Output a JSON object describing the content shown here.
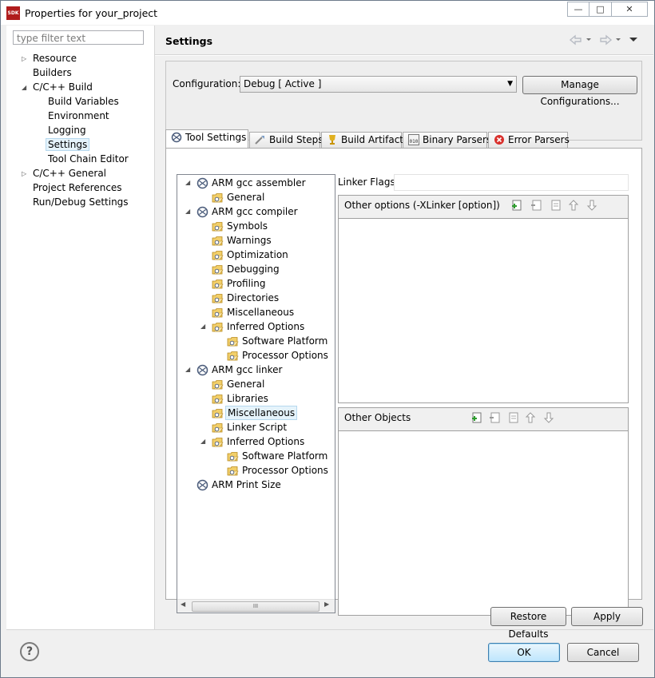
{
  "window": {
    "title": "Properties for your_project",
    "app_icon_text": "SDK",
    "controls": {
      "minimize": "—",
      "maximize": "□",
      "close": "✕"
    }
  },
  "left": {
    "filter_placeholder": "type filter text",
    "items": [
      {
        "label": "Resource"
      },
      {
        "label": "Builders"
      },
      {
        "label": "C/C++ Build"
      },
      {
        "label": "Build Variables"
      },
      {
        "label": "Environment"
      },
      {
        "label": "Logging"
      },
      {
        "label": "Settings"
      },
      {
        "label": "Tool Chain Editor"
      },
      {
        "label": "C/C++ General"
      },
      {
        "label": "Project References"
      },
      {
        "label": "Run/Debug Settings"
      }
    ]
  },
  "right": {
    "title": "Settings",
    "configuration_label": "Configuration:",
    "configuration_value": "Debug  [ Active ]",
    "manage_button": "Manage Configurations...",
    "tabs": [
      {
        "label": "Tool Settings",
        "icon": "tool-settings-icon"
      },
      {
        "label": "Build Steps",
        "icon": "build-steps-icon"
      },
      {
        "label": "Build Artifact",
        "icon": "trophy-icon"
      },
      {
        "label": "Binary Parsers",
        "icon": "binary-icon"
      },
      {
        "label": "Error Parsers",
        "icon": "error-icon"
      }
    ],
    "tool_tree": [
      {
        "label": "ARM gcc assembler"
      },
      {
        "label": "General"
      },
      {
        "label": "ARM gcc compiler"
      },
      {
        "label": "Symbols"
      },
      {
        "label": "Warnings"
      },
      {
        "label": "Optimization"
      },
      {
        "label": "Debugging"
      },
      {
        "label": "Profiling"
      },
      {
        "label": "Directories"
      },
      {
        "label": "Miscellaneous"
      },
      {
        "label": "Inferred Options"
      },
      {
        "label": "Software Platform"
      },
      {
        "label": "Processor Options"
      },
      {
        "label": "ARM gcc linker"
      },
      {
        "label": "General"
      },
      {
        "label": "Libraries"
      },
      {
        "label": "Miscellaneous"
      },
      {
        "label": "Linker Script"
      },
      {
        "label": "Inferred Options"
      },
      {
        "label": "Software Platform"
      },
      {
        "label": "Processor Options"
      },
      {
        "label": "ARM Print Size"
      }
    ],
    "linker_flags_label": "Linker Flags",
    "linker_flags_value": "",
    "other_options_label": "Other options (-XLinker [option])",
    "other_objects_label": "Other Objects",
    "scrollbar_thumb": "III",
    "restore_defaults": "Restore Defaults",
    "apply": "Apply"
  },
  "footer": {
    "help": "?",
    "ok": "OK",
    "cancel": "Cancel"
  },
  "colors": {
    "selection_bg": "#e5f3fb",
    "selection_border": "#b6d8ee",
    "default_button_border": "#3c7fb1",
    "sdk_icon": "#b01c1c"
  }
}
